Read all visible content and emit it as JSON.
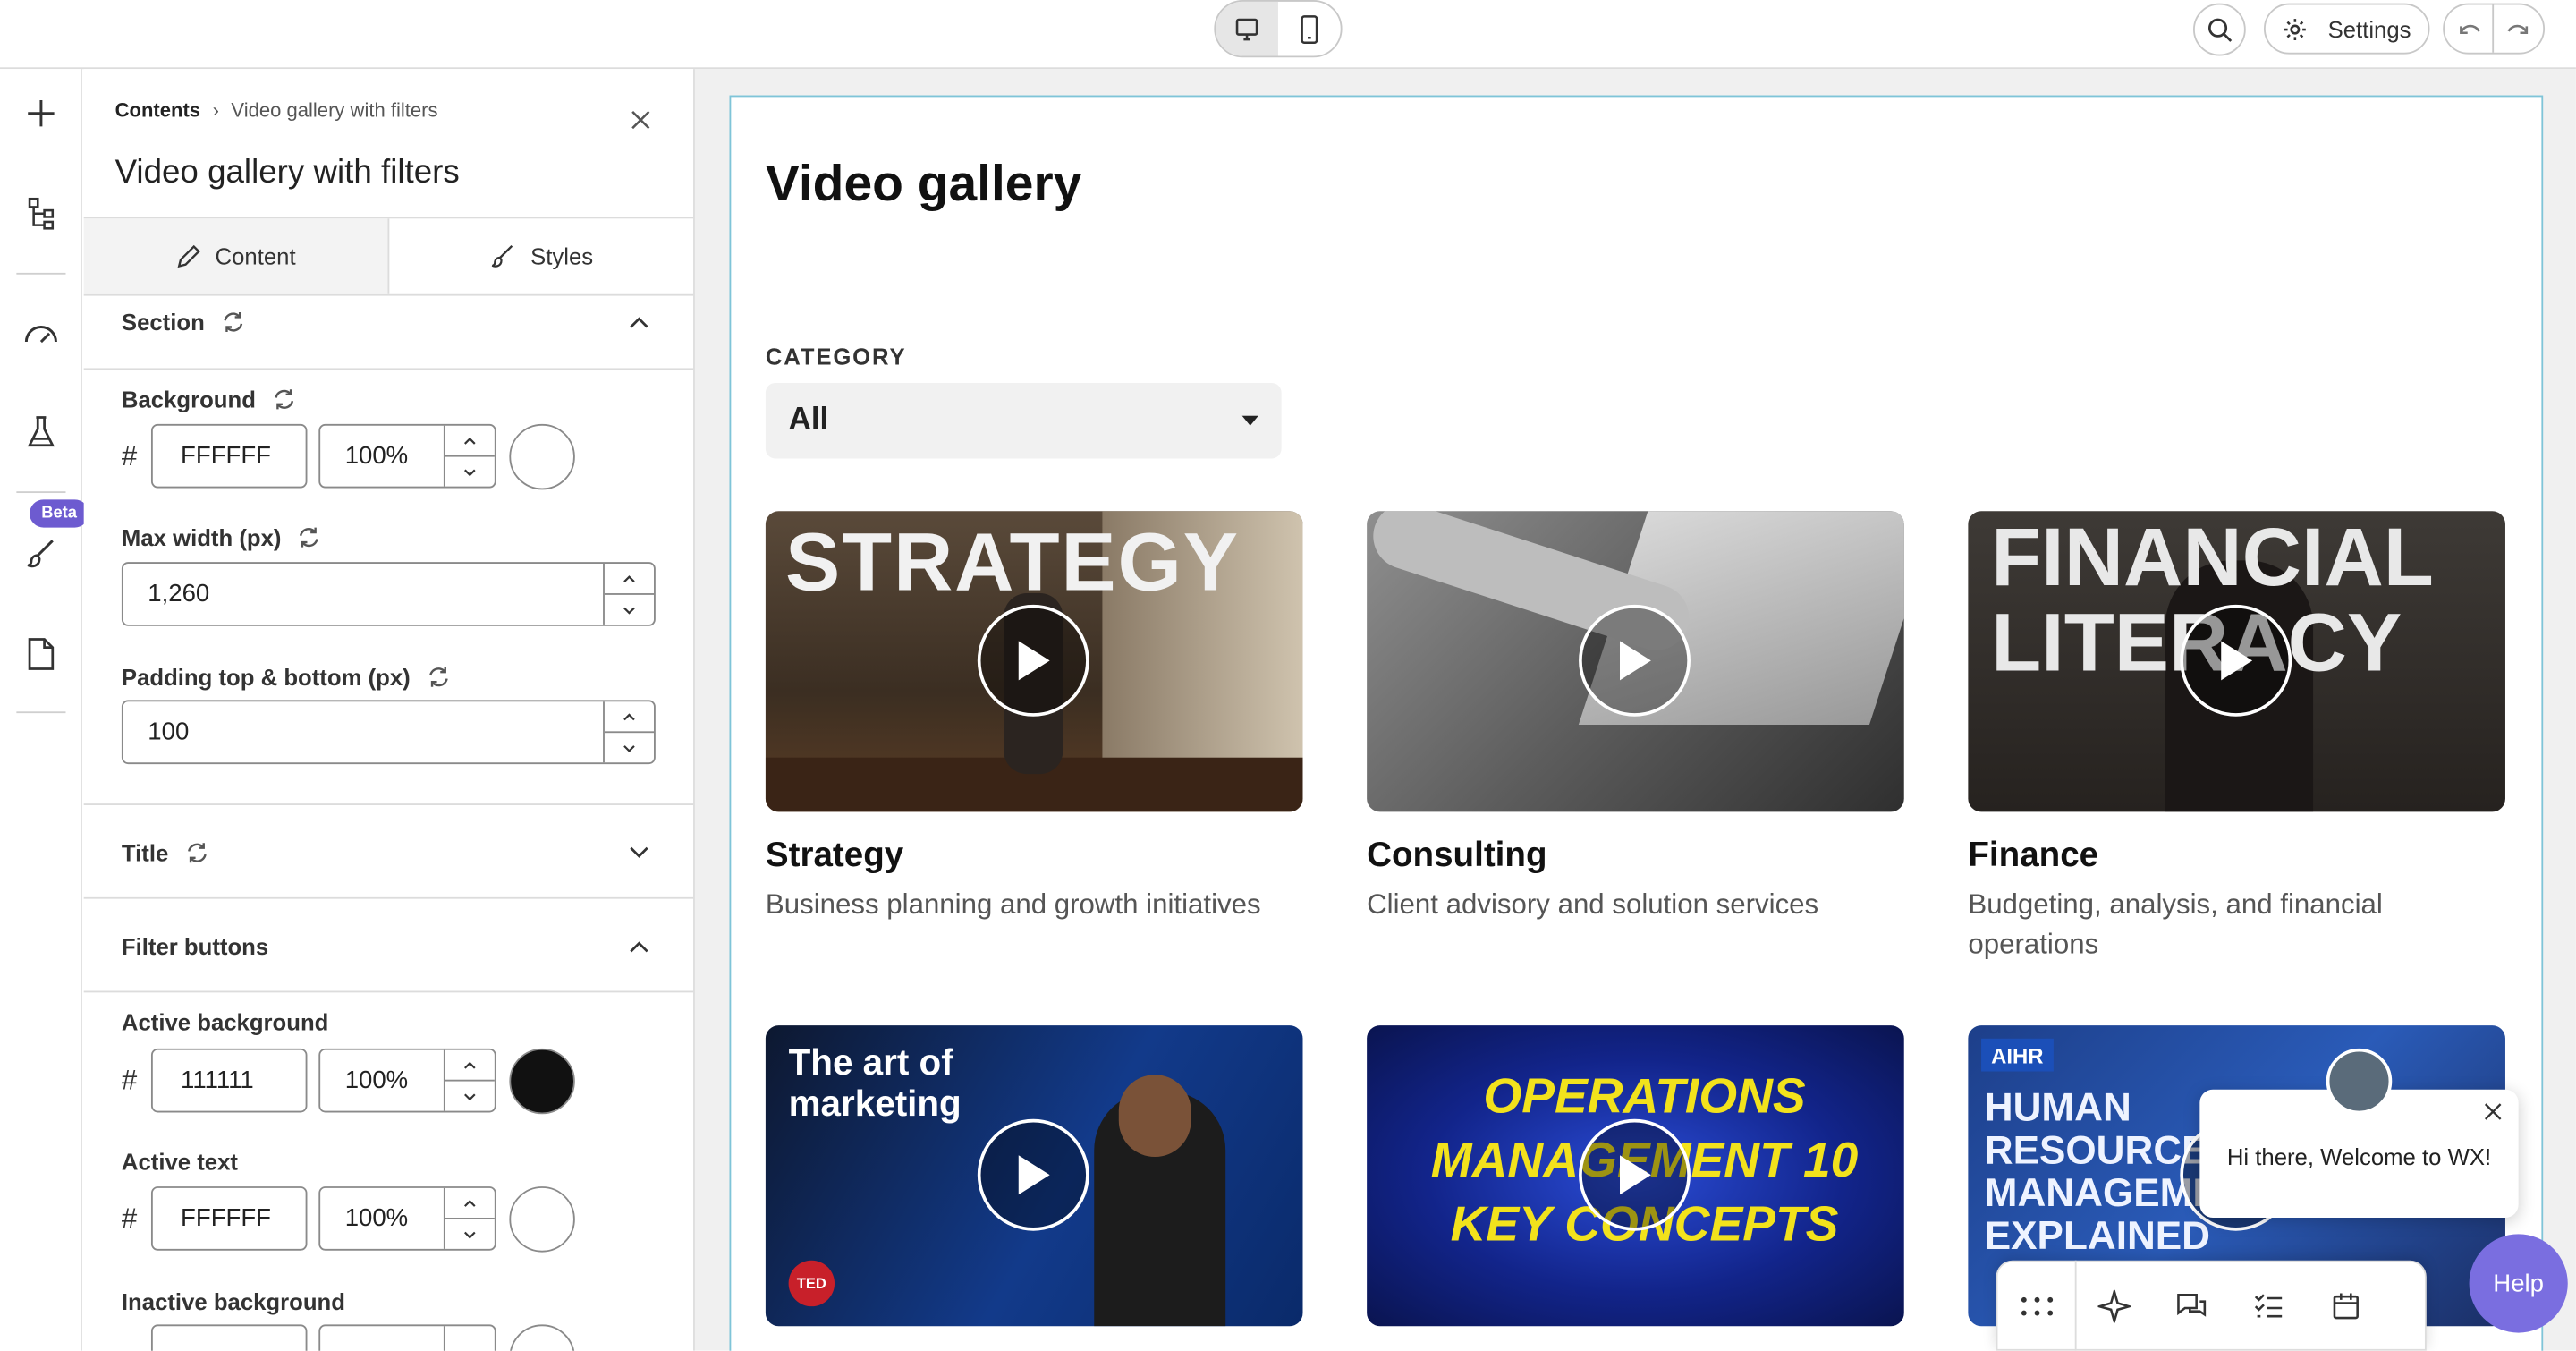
{
  "topbar": {
    "settings_label": "Settings",
    "devices": [
      "desktop-icon",
      "mobile-icon"
    ],
    "active_device": "desktop"
  },
  "rail": {
    "icons": [
      "plus-icon",
      "tree-icon",
      "gauge-icon",
      "flask-icon",
      "brush-icon",
      "page-icon"
    ],
    "beta_label": "Beta"
  },
  "panel": {
    "breadcrumb_root": "Contents",
    "breadcrumb_sep": "›",
    "breadcrumb_current": "Video gallery with filters",
    "title": "Video gallery with filters",
    "tabs": [
      {
        "label": "Content",
        "icon": "pencil-icon"
      },
      {
        "label": "Styles",
        "icon": "brush-icon"
      }
    ],
    "active_tab": "Styles",
    "section": {
      "label": "Section",
      "background": {
        "label": "Background",
        "hash": "#",
        "hex": "FFFFFF",
        "opacity": "100%",
        "swatch": "#ffffff"
      },
      "max_width": {
        "label": "Max width (px)",
        "value": "1,260"
      },
      "padding": {
        "label": "Padding top & bottom (px)",
        "value": "100"
      }
    },
    "title_group": {
      "label": "Title"
    },
    "filter_buttons": {
      "label": "Filter buttons",
      "active_background": {
        "label": "Active background",
        "hash": "#",
        "hex": "111111",
        "opacity": "100%",
        "swatch": "#111111"
      },
      "active_text": {
        "label": "Active text",
        "hash": "#",
        "hex": "FFFFFF",
        "opacity": "100%",
        "swatch": "#ffffff"
      },
      "inactive_background": {
        "label": "Inactive background"
      }
    }
  },
  "gallery": {
    "title": "Video gallery",
    "category_label": "CATEGORY",
    "category_value": "All",
    "cards": [
      {
        "title": "Strategy",
        "desc": "Business planning and growth initiatives",
        "overlay": "STRATEGY"
      },
      {
        "title": "Consulting",
        "desc": "Client advisory and solution services",
        "overlay": ""
      },
      {
        "title": "Finance",
        "desc": "Budgeting, analysis, and financial operations",
        "overlay": "FINANCIAL LITERACY"
      },
      {
        "title": "",
        "desc": "",
        "overlay": "The art of marketing",
        "badge": "TED"
      },
      {
        "title": "",
        "desc": "",
        "overlay": "OPERATIONS MANAGEMENT 10 KEY CONCEPTS"
      },
      {
        "title": "",
        "desc": "",
        "overlay": "HUMAN RESOURCE MANAGEMENT EXPLAINED",
        "badge": "AIHR"
      }
    ]
  },
  "chat": {
    "bubble_text": "Hi there, Welcome to WX!",
    "help_label": "Help",
    "toolbar_icons": [
      "grid-dots-icon",
      "sparkle-icon",
      "chat-icon",
      "checklist-icon",
      "calendar-icon"
    ]
  },
  "colors": {
    "accent": "#7a6ee0",
    "beta": "#6d5bd0",
    "page_border": "#7fc4d8"
  }
}
